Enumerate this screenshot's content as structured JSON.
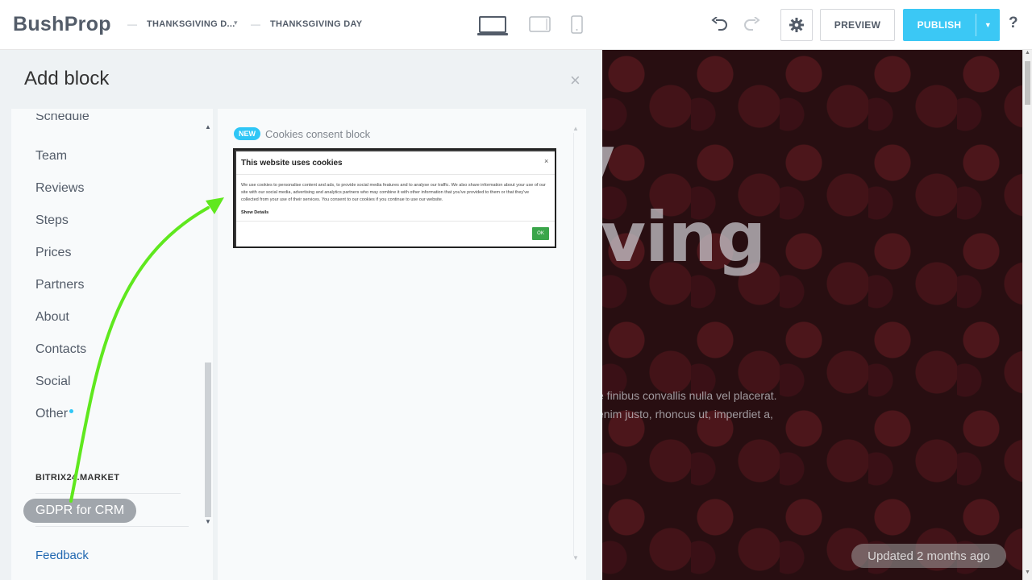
{
  "header": {
    "logo": "BushProp",
    "crumb_site": "THANKSGIVING D...",
    "crumb_page": "THANKSGIVING DAY",
    "preview_label": "PREVIEW",
    "publish_label": "PUBLISH",
    "help_label": "?",
    "devices": [
      "desktop-icon",
      "tablet-icon",
      "mobile-icon"
    ],
    "accent": "#3bc8f5"
  },
  "panel": {
    "title": "Add block",
    "close": "×",
    "categories_partial": "Schedule",
    "categories": [
      "Team",
      "Reviews",
      "Steps",
      "Prices",
      "Partners",
      "About",
      "Contacts",
      "Social",
      "Other"
    ],
    "market_title": "BITRIX24.MARKET",
    "market_items": [
      "GDPR for CRM"
    ],
    "feedback": "Feedback"
  },
  "block": {
    "badge": "NEW",
    "name": "Cookies consent block",
    "dialog_title": "This website uses cookies",
    "dialog_close": "×",
    "dialog_text": "We use cookies to personalise content and ads, to provide social media features and to analyse our traffic. We also share information about your use of our site with our social media, advertising and analytics partners who may combine it with other information that you've provided to them or that they've collected from your use of their services. You consent to our cookies if you continue to use our website.",
    "dialog_details": "Show Details",
    "dialog_ok": "OK"
  },
  "site": {
    "hero_line1": "y",
    "hero_line2": "ving",
    "para_line1": "e finibus convallis nulla vel placerat.",
    "para_line2": "enim justo, rhoncus ut, imperdiet a,",
    "updated": "Updated 2 months ago"
  }
}
